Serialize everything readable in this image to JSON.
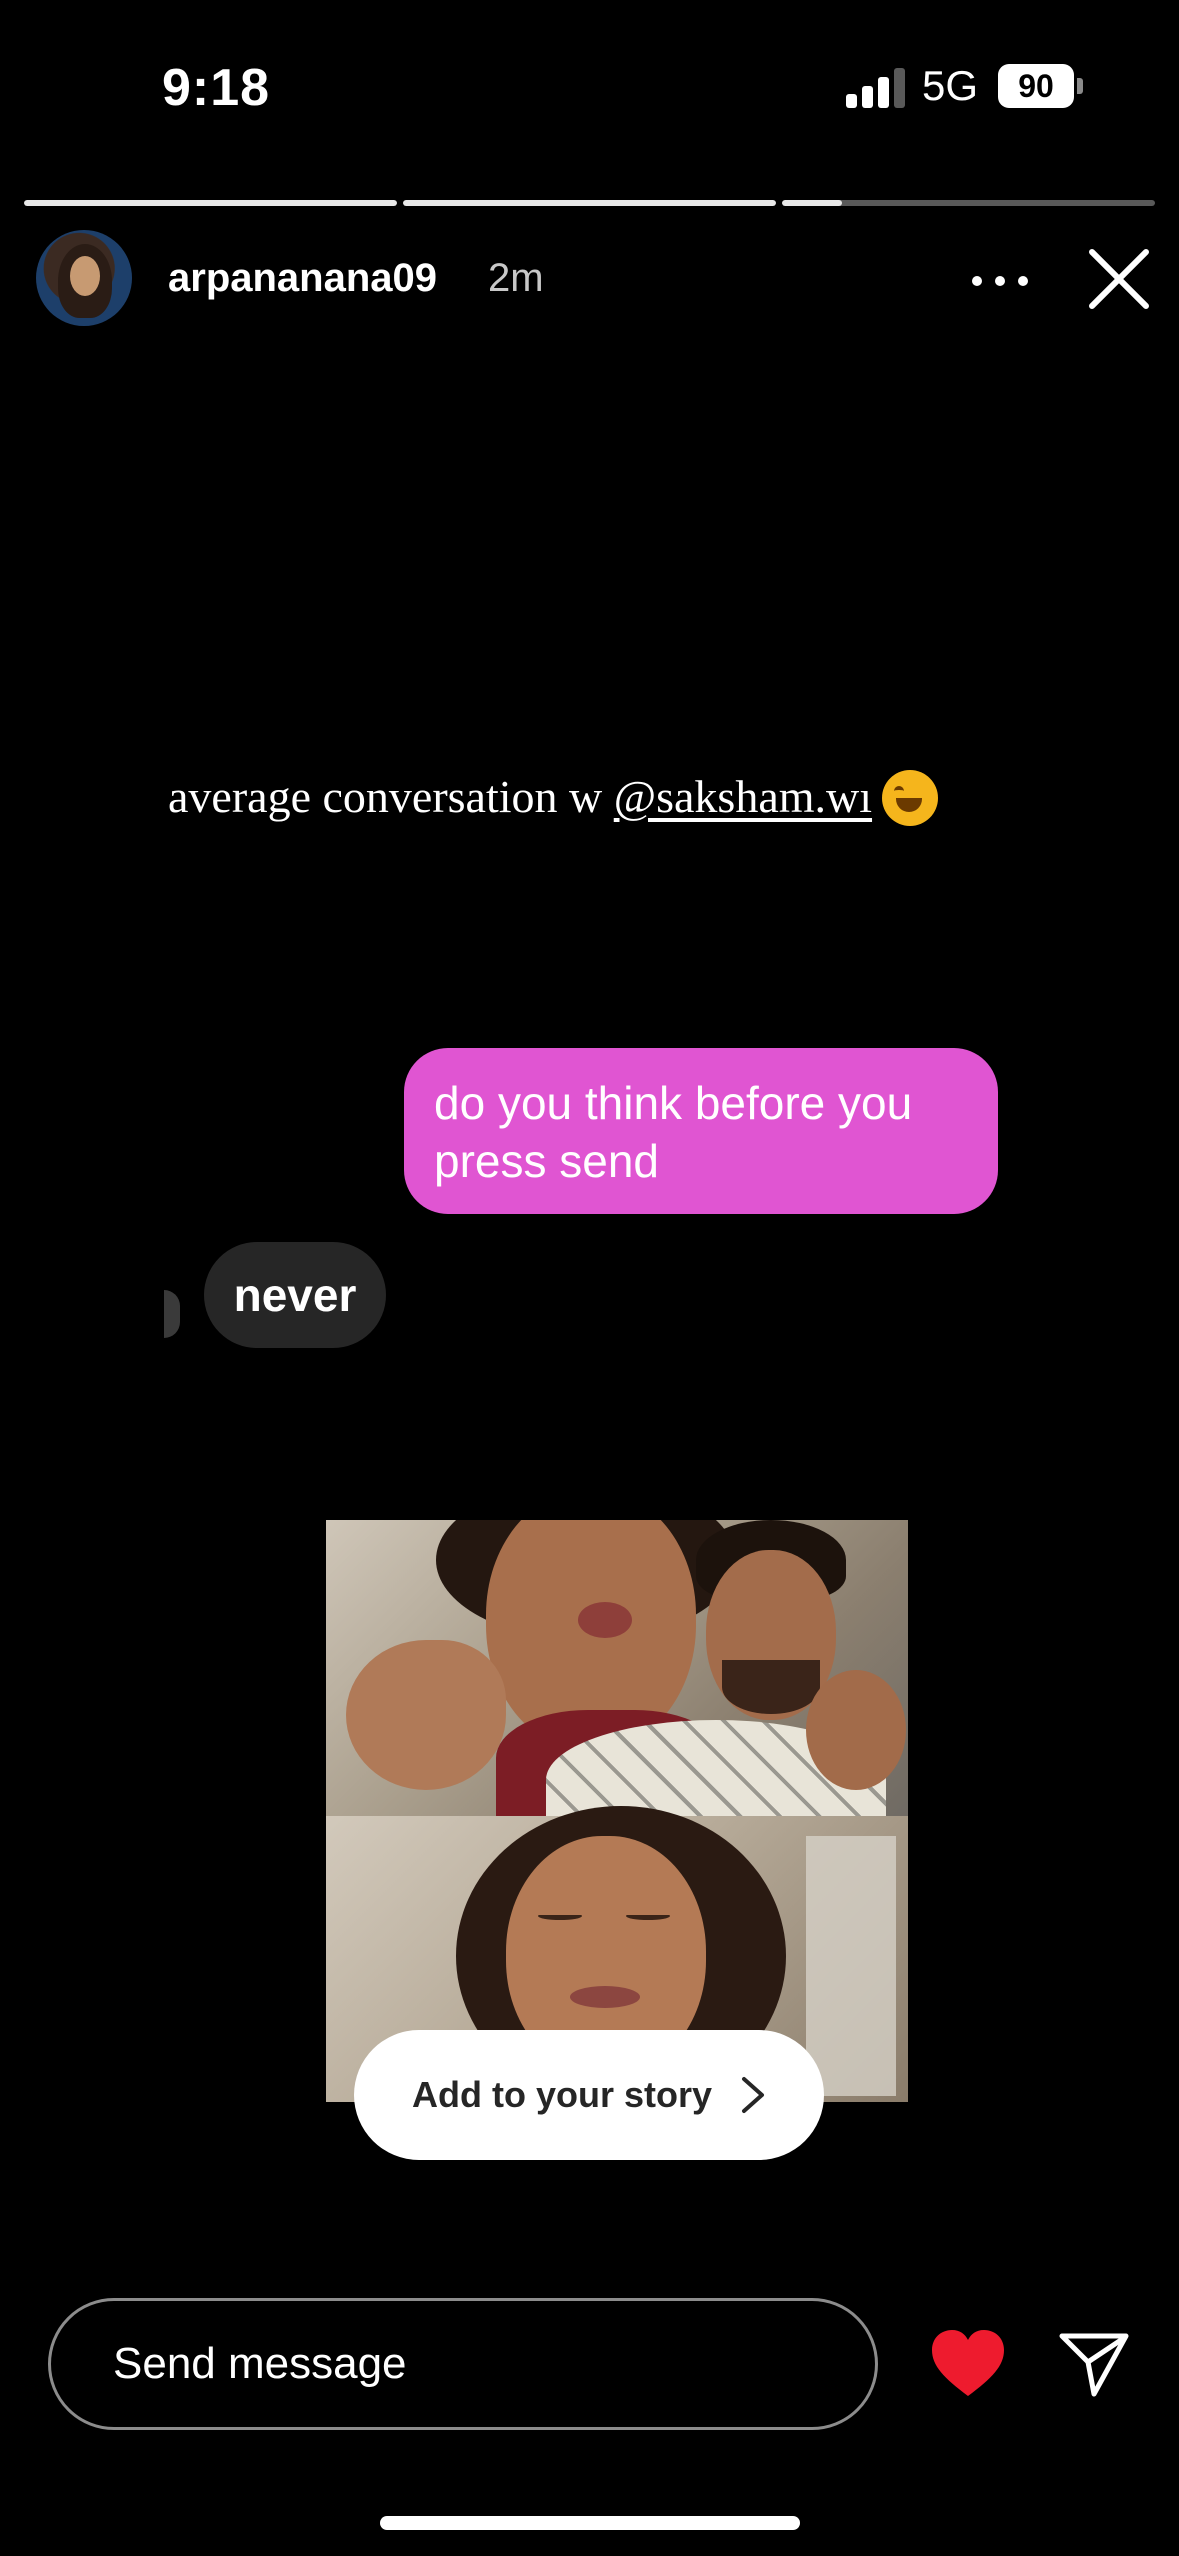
{
  "status_bar": {
    "time": "9:18",
    "network": "5G",
    "battery": "90",
    "signal_bars": 3
  },
  "progress": [
    1,
    1,
    0.16
  ],
  "header": {
    "username": "arpananana09",
    "time_ago": "2m"
  },
  "caption": {
    "text": "average conversation w ",
    "mention": "@saksham.wı"
  },
  "chat": {
    "sent": "do you think before you press send",
    "received": "never"
  },
  "add_story_label": "Add to your story",
  "message_placeholder": "Send message",
  "colors": {
    "sent_bubble": "#e055d2",
    "received_bubble": "#262626",
    "heart": "#ee1b2e"
  }
}
